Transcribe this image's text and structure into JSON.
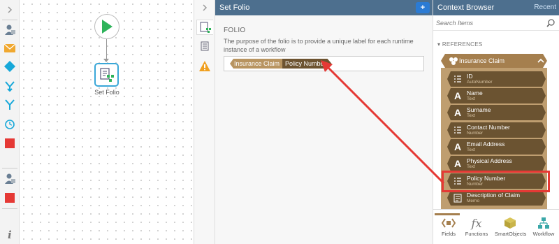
{
  "canvas": {
    "node_label": "Set Folio"
  },
  "panel": {
    "title": "Set Folio",
    "section_title": "FOLIO",
    "description": "The purpose of the folio is to provide a unique label for each runtime instance of a workflow",
    "tokens": {
      "first": "Insurance Claim",
      "second": "Policy Number"
    }
  },
  "context": {
    "title": "Context Browser",
    "recent": "Recent",
    "search_placeholder": "Search Items",
    "references_label": "REFERENCES",
    "group": "Insurance Claim",
    "fields": [
      {
        "name": "ID",
        "type": "AutoNumber",
        "icon": "list-icon"
      },
      {
        "name": "Name",
        "type": "Text",
        "icon": "text-icon"
      },
      {
        "name": "Surname",
        "type": "Text",
        "icon": "text-icon"
      },
      {
        "name": "Contact Number",
        "type": "Number",
        "icon": "list-icon"
      },
      {
        "name": "Email Address",
        "type": "Text",
        "icon": "text-icon"
      },
      {
        "name": "Physical Address",
        "type": "Text",
        "icon": "text-icon"
      },
      {
        "name": "Policy Number",
        "type": "Number",
        "icon": "list-icon"
      },
      {
        "name": "Description of Claim",
        "type": "Memo",
        "icon": "memo-icon"
      }
    ],
    "bottom_tabs": [
      "Fields",
      "Functions",
      "SmartObjects",
      "Workflow"
    ]
  },
  "colors": {
    "header": "#4d6f8e",
    "accent": "#a57f4e",
    "field": "#6b5331",
    "highlight": "#e53935",
    "arrow": "#e53935"
  }
}
